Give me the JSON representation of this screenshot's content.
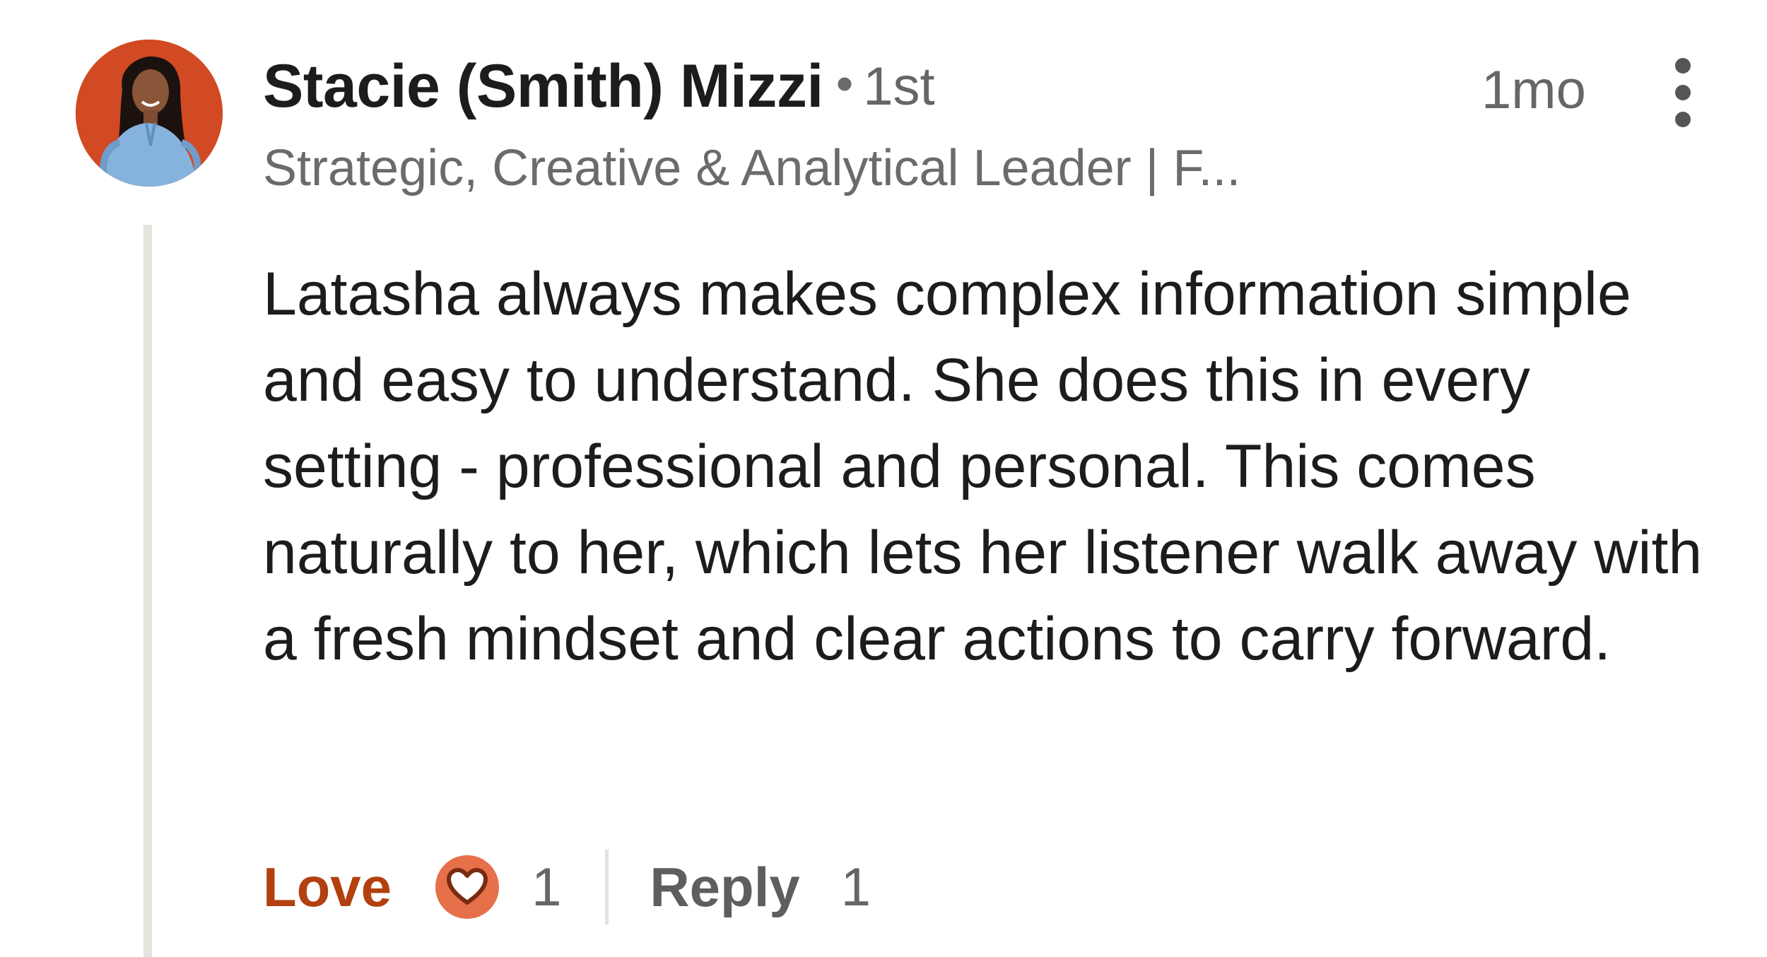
{
  "comment": {
    "author": {
      "name": "Stacie (Smith) Mizzi",
      "separator": "•",
      "connection_degree": "1st",
      "headline": "Strategic, Creative & Analytical Leader | F..."
    },
    "timestamp": "1mo",
    "more_icon": "vertical-ellipsis-icon",
    "text": "Latasha always makes complex information simple and easy to understand. She does this in every setting - professional and personal. This comes naturally to her, which lets her listener walk away with a fresh mindset and clear actions to carry forward.",
    "actions": {
      "love_label": "Love",
      "reaction_icon": "heart-icon",
      "reaction_count": "1",
      "reply_label": "Reply",
      "reply_count": "1"
    }
  },
  "colors": {
    "love_accent": "#b3400f",
    "reaction_badge": "#e5704a",
    "avatar_background": "#d24a23",
    "thread_line": "#e6e3df"
  }
}
